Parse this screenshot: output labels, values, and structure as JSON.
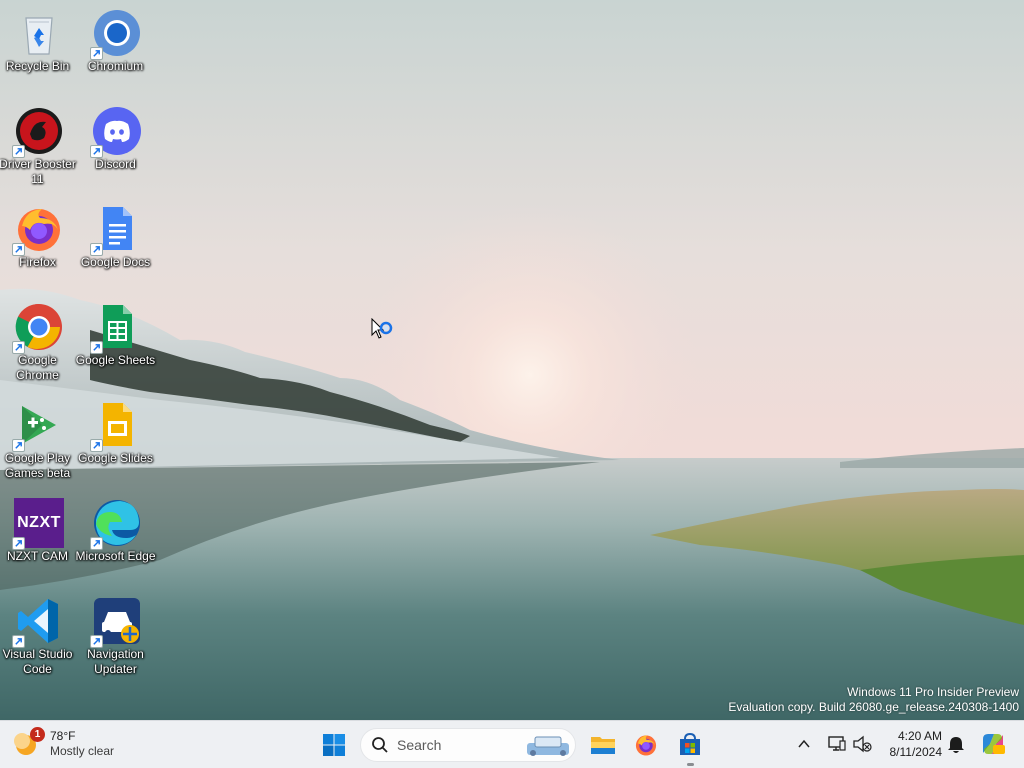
{
  "desktop": {
    "icons": [
      {
        "label": "Recycle Bin",
        "icon": "recycle-bin-icon"
      },
      {
        "label": "Chromium",
        "icon": "chromium-icon"
      },
      {
        "label": "Driver Booster 11",
        "icon": "driver-booster-icon"
      },
      {
        "label": "Discord",
        "icon": "discord-icon"
      },
      {
        "label": "Firefox",
        "icon": "firefox-icon"
      },
      {
        "label": "Google Docs",
        "icon": "google-docs-icon"
      },
      {
        "label": "Google Chrome",
        "icon": "google-chrome-icon"
      },
      {
        "label": "Google Sheets",
        "icon": "google-sheets-icon"
      },
      {
        "label": "Google Play Games beta",
        "icon": "google-play-games-icon"
      },
      {
        "label": "Google Slides",
        "icon": "google-slides-icon"
      },
      {
        "label": "NZXT CAM",
        "icon": "nzxt-cam-icon"
      },
      {
        "label": "Microsoft Edge",
        "icon": "microsoft-edge-icon"
      },
      {
        "label": "Visual Studio Code",
        "icon": "vscode-icon"
      },
      {
        "label": "Navigation Updater",
        "icon": "navigation-updater-icon"
      }
    ],
    "nzxt_logo_text": "NZXT"
  },
  "watermark": {
    "line1": "Windows 11 Pro Insider Preview",
    "line2": "Evaluation copy. Build 26080.ge_release.240308-1400"
  },
  "taskbar": {
    "weather": {
      "temp": "78°F",
      "condition": "Mostly clear",
      "badge": "1"
    },
    "search": {
      "placeholder": "Search"
    },
    "clock": {
      "time": "4:20 AM",
      "date": "8/11/2024"
    },
    "pinned": [
      "start-button",
      "search-box",
      "file-explorer-button",
      "firefox-button",
      "microsoft-store-button"
    ]
  },
  "colors": {
    "taskbar_bg": "#eef0f3",
    "accent_blue": "#0078d4",
    "badge_red": "#c42b1c"
  }
}
